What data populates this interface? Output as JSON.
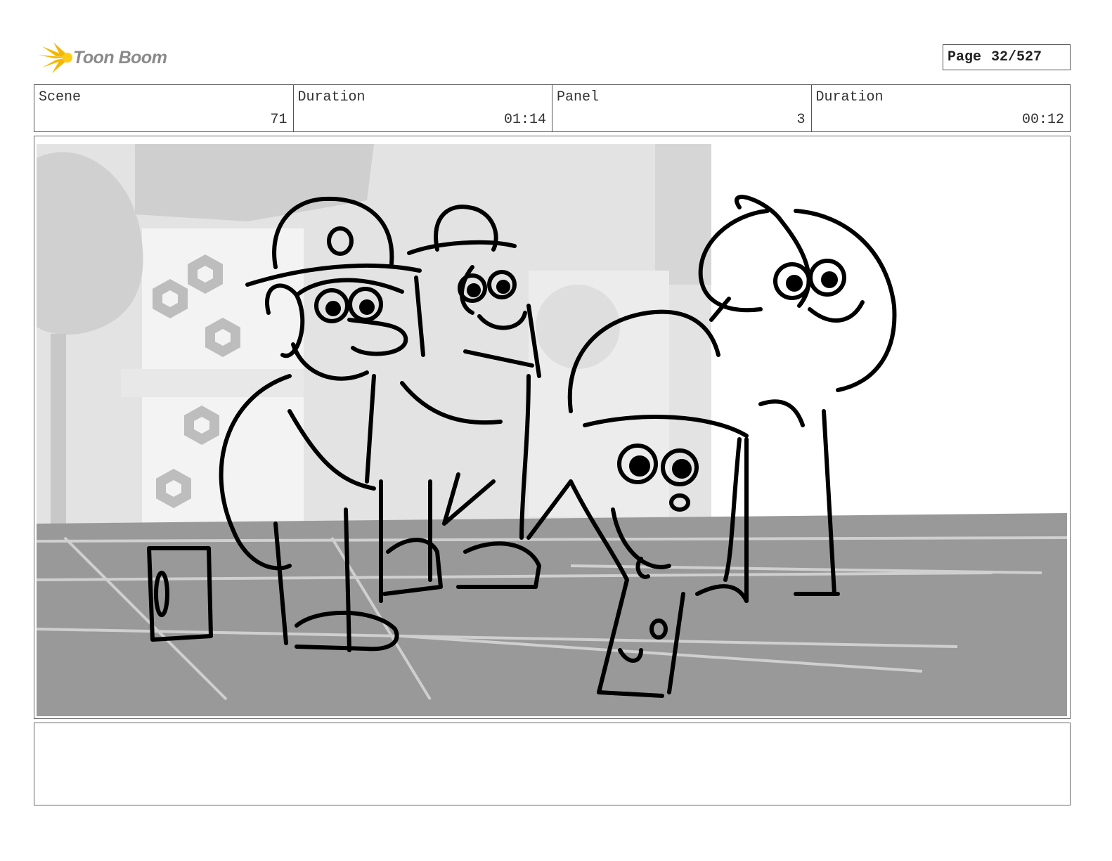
{
  "brand": {
    "logo_text": "Toon Boom",
    "logo_color": "#f5b800"
  },
  "page": {
    "label": "Page",
    "value": "32/527"
  },
  "info": {
    "scene": {
      "label": "Scene",
      "value": "71"
    },
    "scene_duration": {
      "label": "Duration",
      "value": "01:14"
    },
    "panel": {
      "label": "Panel",
      "value": "3"
    },
    "panel_duration": {
      "label": "Duration",
      "value": "00:12"
    }
  },
  "notes": {
    "text": ""
  },
  "colors": {
    "border": "#555555",
    "floor": "#999999",
    "background_gray": "#dcdcdc",
    "ink": "#000000"
  }
}
